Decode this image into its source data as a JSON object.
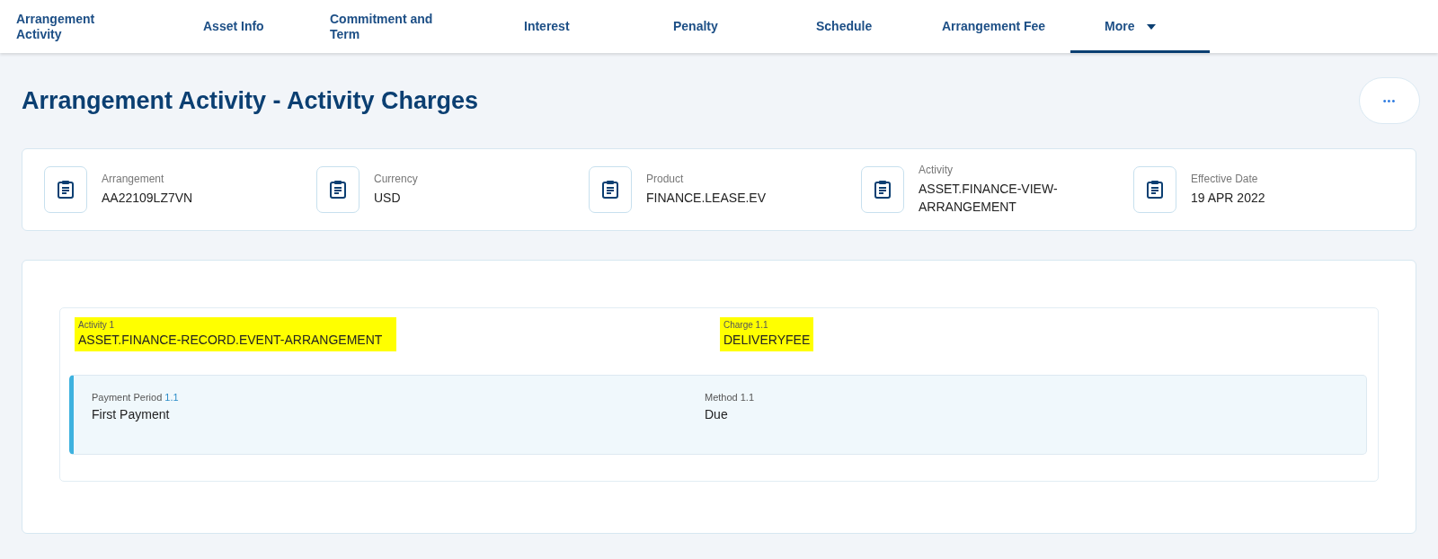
{
  "tabs": [
    {
      "label": "Arrangement Activity",
      "selected": false,
      "dropdown": false
    },
    {
      "label": "Asset Info",
      "selected": false,
      "dropdown": false
    },
    {
      "label": "Commitment and Term",
      "selected": false,
      "dropdown": false
    },
    {
      "label": "Interest",
      "selected": false,
      "dropdown": false
    },
    {
      "label": "Penalty",
      "selected": false,
      "dropdown": false
    },
    {
      "label": "Schedule",
      "selected": false,
      "dropdown": false
    },
    {
      "label": "Arrangement Fee",
      "selected": false,
      "dropdown": false
    },
    {
      "label": "More",
      "selected": true,
      "dropdown": true
    }
  ],
  "page_title": "Arrangement Activity - Activity Charges",
  "more_button": {
    "label": "•••"
  },
  "summary": [
    {
      "label": "Arrangement",
      "value": "AA22109LZ7VN"
    },
    {
      "label": "Currency",
      "value": "USD"
    },
    {
      "label": "Product",
      "value": "FINANCE.LEASE.EV"
    },
    {
      "label": "Activity",
      "value": "ASSET.FINANCE-VIEW-ARRANGEMENT"
    },
    {
      "label": "Effective Date",
      "value": "19 APR 2022"
    }
  ],
  "activity": {
    "fields": [
      {
        "label": "Activity 1",
        "value": "ASSET.FINANCE-RECORD.EVENT-ARRANGEMENT",
        "highlighted": true
      },
      {
        "label": "Charge 1.1",
        "value": "DELIVERYFEE",
        "highlighted": true
      }
    ],
    "detail": [
      {
        "label": "Payment Period",
        "index": "1.1",
        "value": "First Payment"
      },
      {
        "label": "Method 1.1",
        "value": "Due"
      }
    ]
  }
}
